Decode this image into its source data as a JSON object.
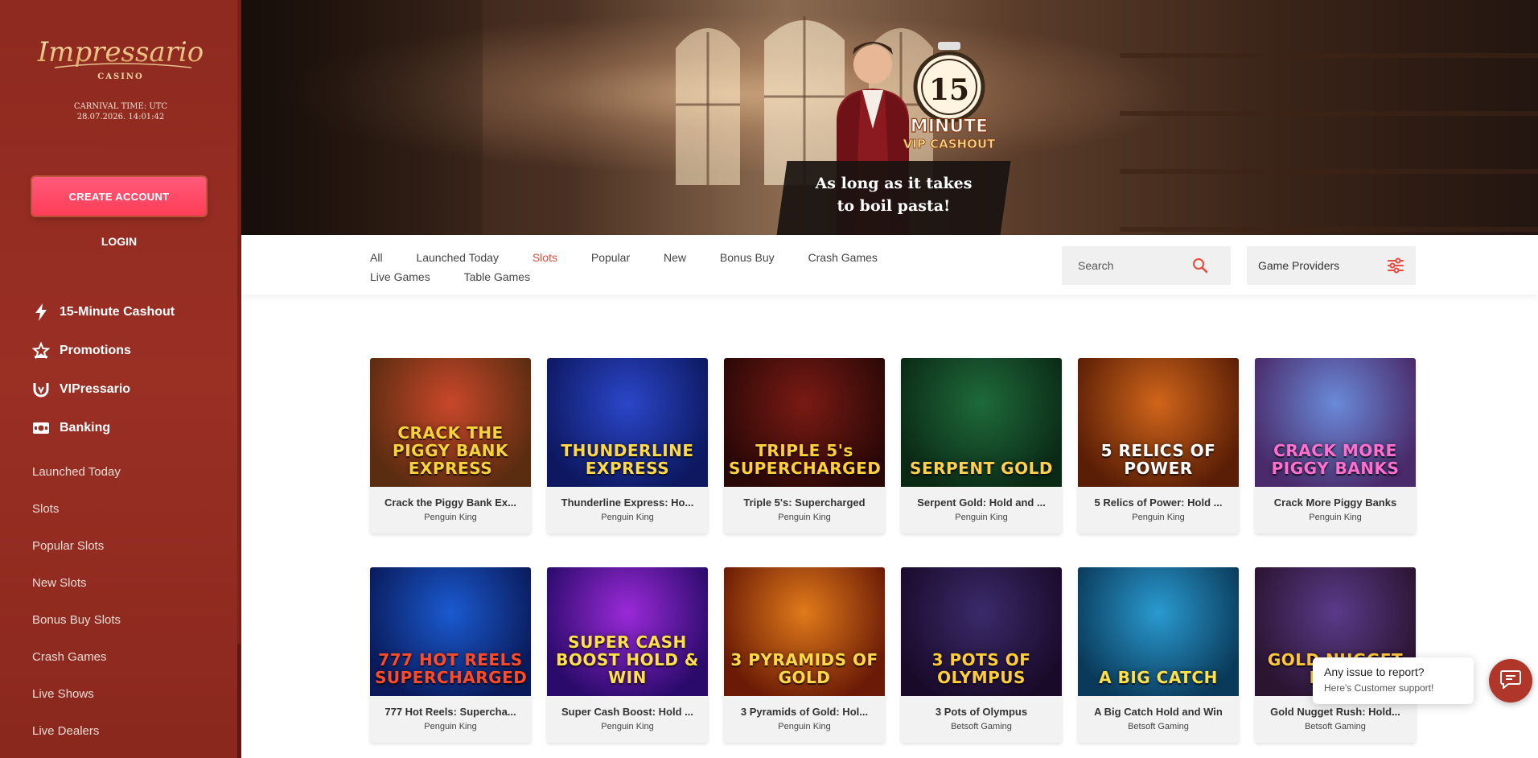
{
  "sidebar": {
    "logo_text": "Impressario",
    "logo_subtext": "CASINO",
    "carnival_label": "CARNIVAL TIME: UTC",
    "carnival_time": "28.07.2026. 14:01:42",
    "create_account_label": "CREATE ACCOUNT",
    "login_label": "LOGIN",
    "main_nav": [
      {
        "label": "15-Minute Cashout",
        "icon": "lightning-icon"
      },
      {
        "label": "Promotions",
        "icon": "star-badge-icon"
      },
      {
        "label": "VIPressario",
        "icon": "vip-icon"
      },
      {
        "label": "Banking",
        "icon": "wallet-icon"
      }
    ],
    "sub_nav": [
      "Launched Today",
      "Slots",
      "Popular Slots",
      "New Slots",
      "Bonus Buy Slots",
      "Crash Games",
      "Live Shows",
      "Live Dealers"
    ]
  },
  "hero": {
    "badge_number": "15",
    "badge_line1": "MINUTE",
    "badge_line2": "VIP CASHOUT",
    "tagline_line1": "As long as it takes",
    "tagline_line2": "to boil pasta!"
  },
  "filters": {
    "tabs": [
      "All",
      "Launched Today",
      "Slots",
      "Popular",
      "New",
      "Bonus Buy",
      "Crash Games",
      "Live Games",
      "Table Games"
    ],
    "active_tab": "Slots",
    "search_placeholder": "Search",
    "providers_label": "Game Providers"
  },
  "games": [
    {
      "title": "Crack the Piggy Bank Ex...",
      "provider": "Penguin King",
      "art_text": "CRACK THE PIGGY BANK EXPRESS",
      "colors": [
        "#c9472a",
        "#5a2c10"
      ],
      "text_color": "#f7d23a"
    },
    {
      "title": "Thunderline Express: Ho...",
      "provider": "Penguin King",
      "art_text": "THUNDERLINE EXPRESS",
      "colors": [
        "#2b46c9",
        "#0d1860"
      ],
      "text_color": "#ffd84a"
    },
    {
      "title": "Triple 5's: Supercharged",
      "provider": "Penguin King",
      "art_text": "TRIPLE 5's SUPERCHARGED",
      "colors": [
        "#7a1a14",
        "#2a0806"
      ],
      "text_color": "#ffcf3a"
    },
    {
      "title": "Serpent Gold: Hold and ...",
      "provider": "Penguin King",
      "art_text": "SERPENT GOLD",
      "colors": [
        "#1e6a3a",
        "#0b2a16"
      ],
      "text_color": "#ffd050"
    },
    {
      "title": "5 Relics of Power: Hold ...",
      "provider": "Penguin King",
      "art_text": "5 RELICS OF POWER",
      "colors": [
        "#d0651a",
        "#5a1e06"
      ],
      "text_color": "#ffffff"
    },
    {
      "title": "Crack More Piggy Banks",
      "provider": "Penguin King",
      "art_text": "CRACK MORE PIGGY BANKS",
      "colors": [
        "#6a8ad8",
        "#4a2a6a"
      ],
      "text_color": "#ff6fd0"
    },
    {
      "title": "777 Hot Reels: Supercha...",
      "provider": "Penguin King",
      "art_text": "777 HOT REELS SUPERCHARGED",
      "colors": [
        "#1a5ad0",
        "#0a1a5a"
      ],
      "text_color": "#ff4a2a"
    },
    {
      "title": "Super Cash Boost: Hold ...",
      "provider": "Penguin King",
      "art_text": "SUPER CASH BOOST HOLD & WIN",
      "colors": [
        "#9a2ad8",
        "#2a0a6a"
      ],
      "text_color": "#ffe04a"
    },
    {
      "title": "3 Pyramids of Gold: Hol...",
      "provider": "Penguin King",
      "art_text": "3 PYRAMIDS OF GOLD",
      "colors": [
        "#e07a1a",
        "#6a1a06"
      ],
      "text_color": "#ffd84a"
    },
    {
      "title": "3 Pots of Olympus",
      "provider": "Betsoft Gaming",
      "art_text": "3 POTS OF OLYMPUS",
      "colors": [
        "#3a2a6a",
        "#1a0a2a"
      ],
      "text_color": "#ffcc3a"
    },
    {
      "title": "A Big Catch Hold and Win",
      "provider": "Betsoft Gaming",
      "art_text": "A BIG CATCH",
      "colors": [
        "#2a9ad0",
        "#0a3a5a"
      ],
      "text_color": "#ffe04a"
    },
    {
      "title": "Gold Nugget Rush: Hold...",
      "provider": "Betsoft Gaming",
      "art_text": "GOLD NUGGET RUSH",
      "colors": [
        "#5a3a8a",
        "#2a1430"
      ],
      "text_color": "#ffc83a"
    }
  ],
  "support": {
    "line1": "Any issue to report?",
    "line2": "Here's Customer support!",
    "icon": "chat-icon"
  },
  "colors": {
    "sidebar_bg": "#9a2f24",
    "accent_pink": "#ff3d57",
    "active_tab": "#e8483a",
    "support_btn": "#b0362a"
  }
}
